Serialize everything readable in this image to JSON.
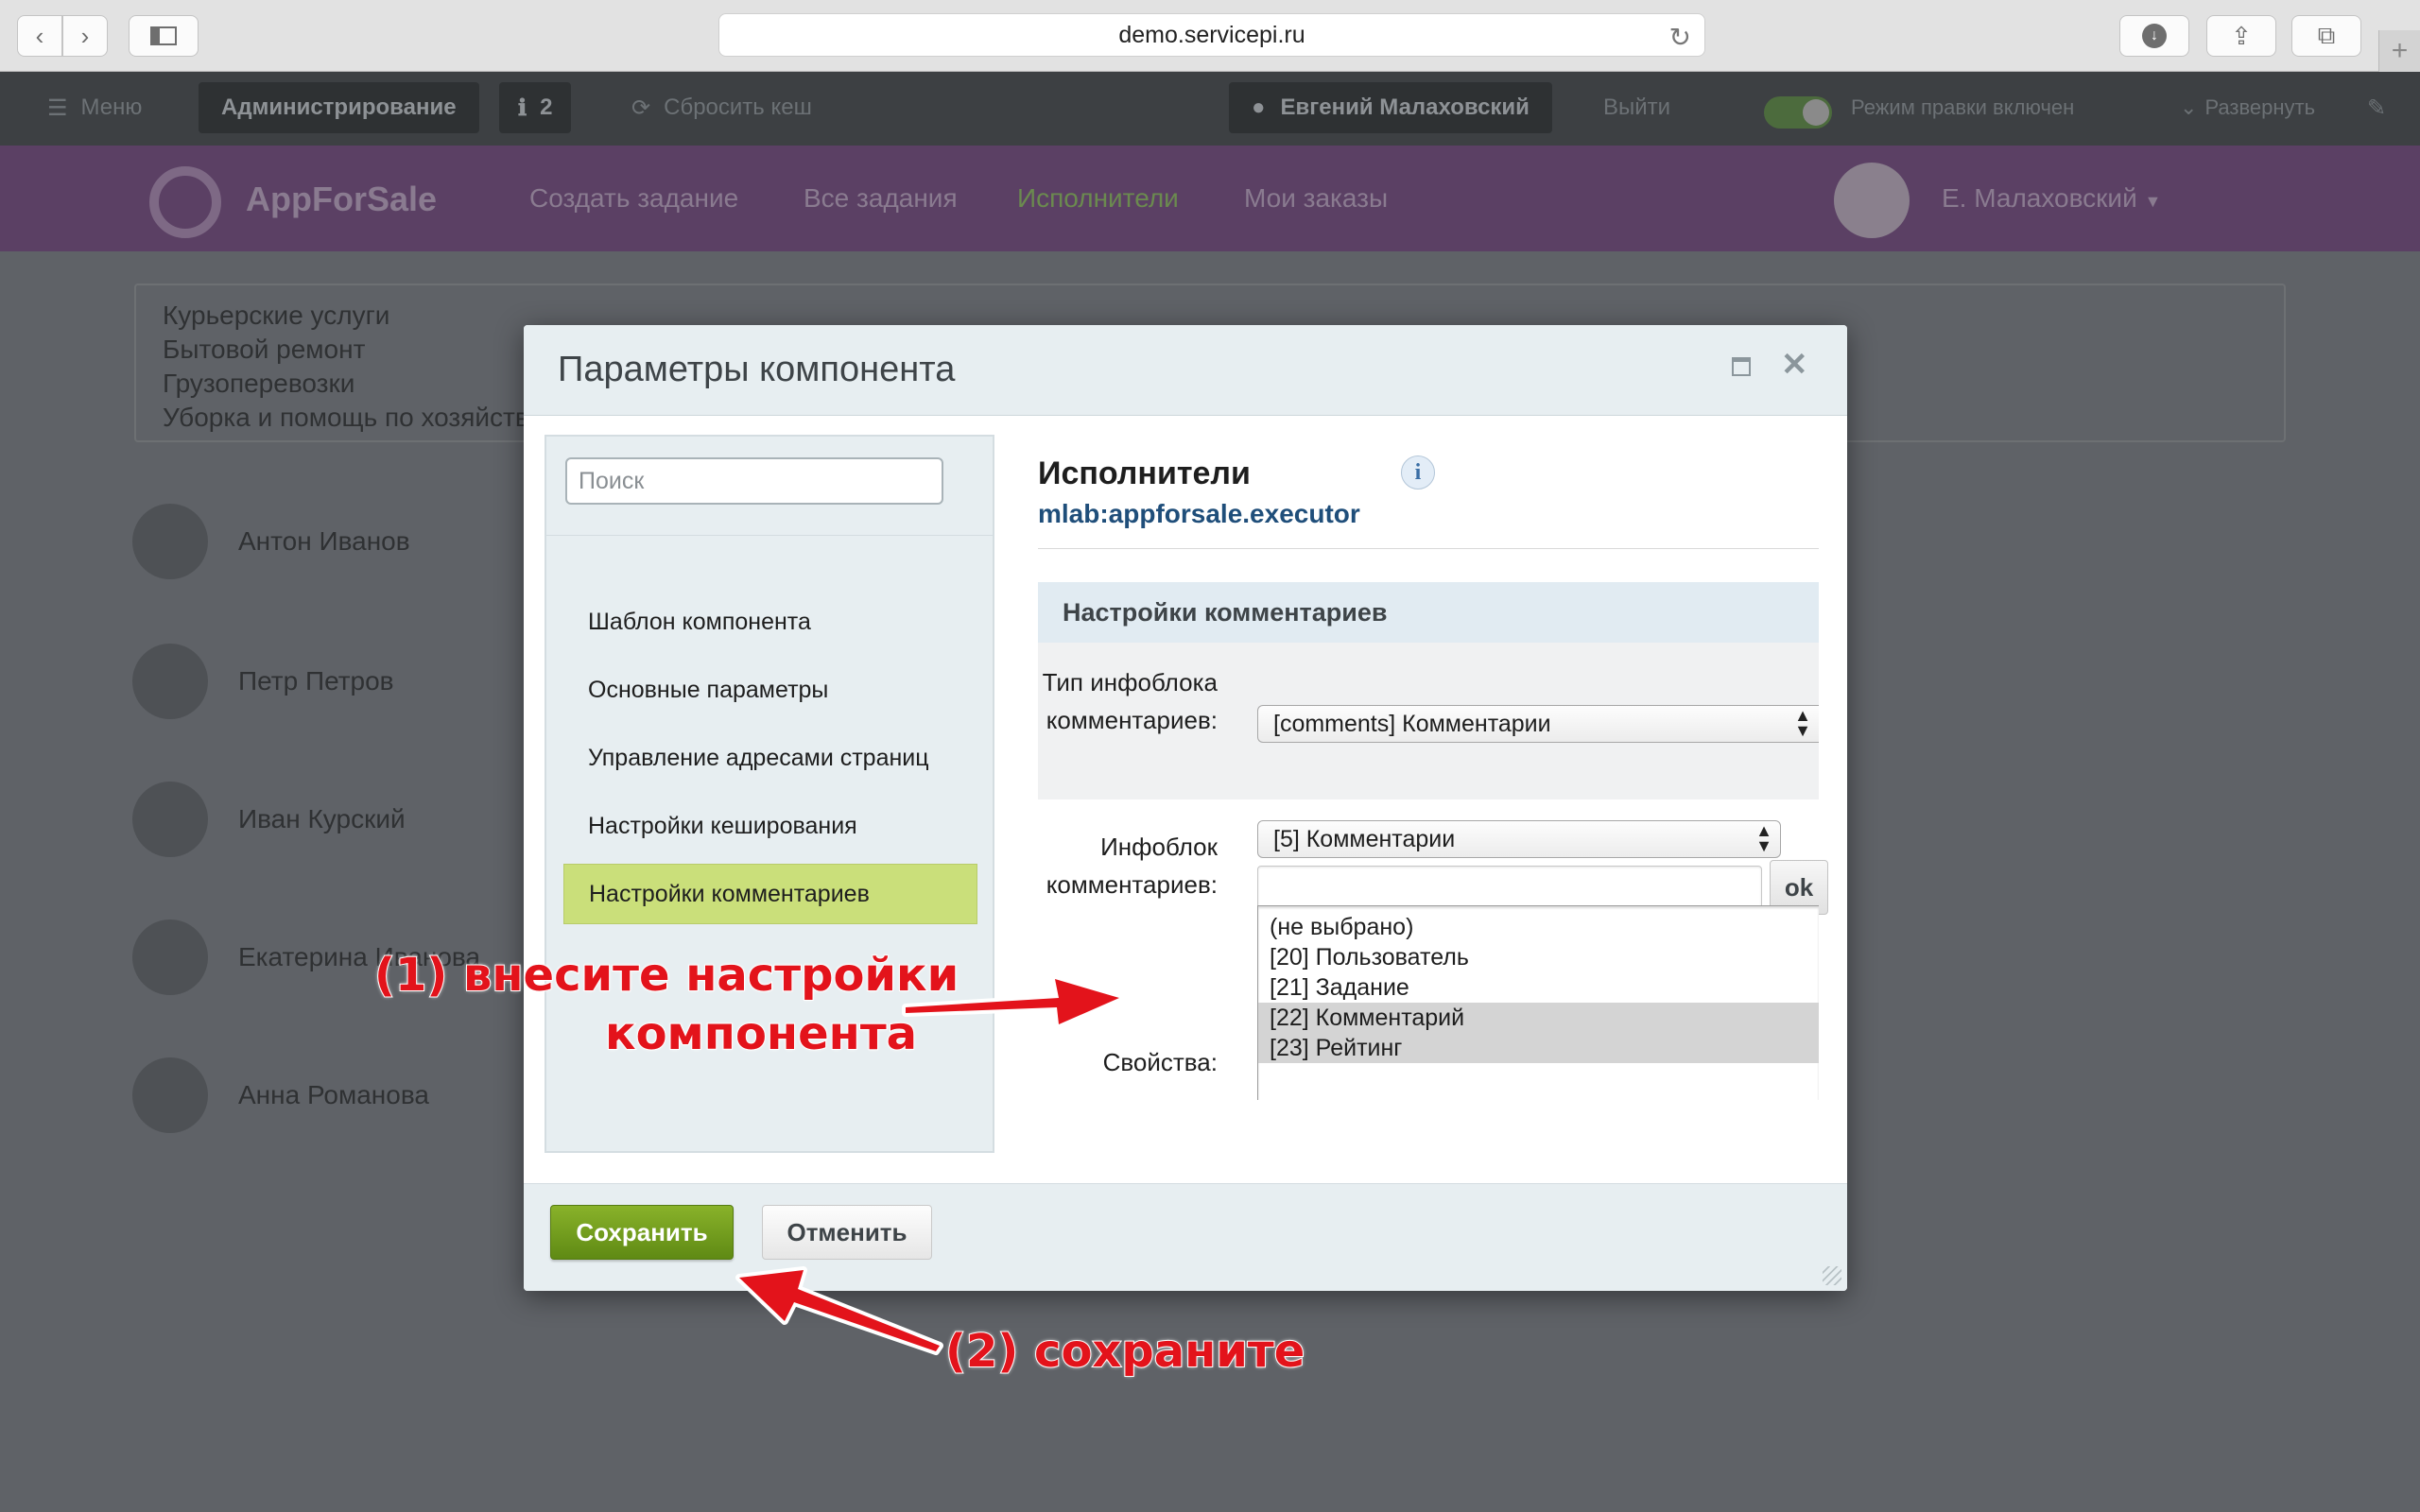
{
  "browser": {
    "url": "demo.servicepi.ru"
  },
  "admin_bar": {
    "menu": "Меню",
    "admin": "Администрирование",
    "notifications": "2",
    "reset_cache": "Сбросить кеш",
    "user": "Евгений Малаховский",
    "logout": "Выйти",
    "edit_mode": "Режим правки включен",
    "expand": "Развернуть"
  },
  "site_header": {
    "logo": "AppForSale",
    "nav": [
      "Создать задание",
      "Все задания",
      "Исполнители",
      "Мои заказы"
    ],
    "active_nav_index": 2,
    "user": "Е. Малаховский"
  },
  "categories": [
    "Курьерские услуги",
    "Бытовой ремонт",
    "Грузоперевозки",
    "Уборка и помощь по хозяйству"
  ],
  "executors": [
    "Антон Иванов",
    "Петр Петров",
    "Иван Курский",
    "Екатерина Иванова",
    "Анна Романова"
  ],
  "dialog": {
    "title": "Параметры компонента",
    "search_placeholder": "Поиск",
    "sections": [
      "Шаблон компонента",
      "Основные параметры",
      "Управление адресами страниц",
      "Настройки кеширования",
      "Настройки комментариев"
    ],
    "selected_section_index": 4,
    "component_title": "Исполнители",
    "component_id": "mlab:appforsale.executor",
    "section_header": "Настройки комментариев",
    "fields": {
      "iblock_type_label": "Тип инфоблока комментариев:",
      "iblock_type_value": "[comments] Комментарии",
      "iblock_label": "Инфоблок комментариев:",
      "iblock_value": "[5] Комментарии",
      "ok_label": "ok",
      "properties_label": "Свойства:",
      "properties_options": [
        {
          "label": "(не выбрано)",
          "selected": false
        },
        {
          "label": "[20] Пользователь",
          "selected": false
        },
        {
          "label": "[21] Задание",
          "selected": false
        },
        {
          "label": "[22] Комментарий",
          "selected": true
        },
        {
          "label": "[23] Рейтинг",
          "selected": true
        }
      ]
    },
    "save_label": "Сохранить",
    "cancel_label": "Отменить"
  },
  "annotations": {
    "step1_line1": "(1) внесите настройки",
    "step1_line2": "компонента",
    "step2": "(2) сохраните",
    "color": "#e3131b"
  }
}
